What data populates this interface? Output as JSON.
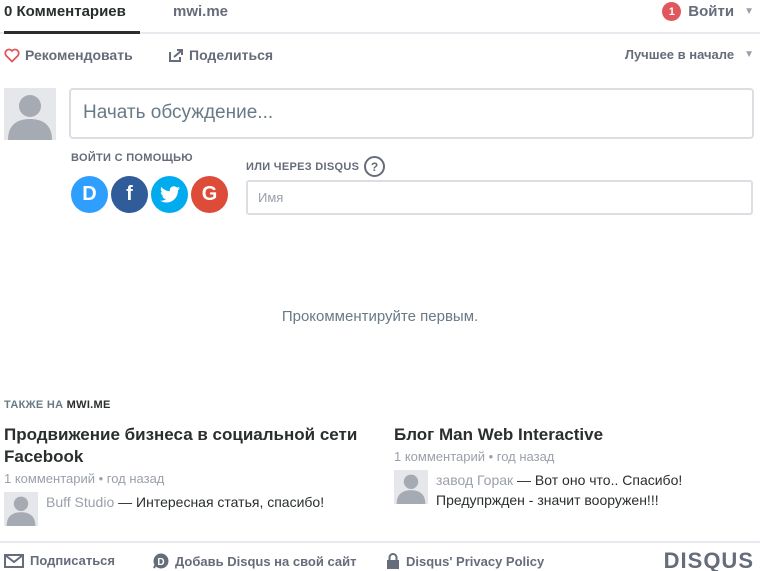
{
  "nav": {
    "comments_tab": "0 Комментариев",
    "site_tab": "mwi.me",
    "notification_count": "1",
    "login_label": "Войти"
  },
  "actions": {
    "recommend": "Рекомендовать",
    "share": "Поделиться",
    "sort": "Лучшее в начале"
  },
  "composer": {
    "placeholder": "Начать обсуждение...",
    "login_with_label": "ВОЙТИ С ПОМОЩЬЮ",
    "or_disqus_label": "ИЛИ ЧЕРЕЗ DISQUS",
    "help": "?",
    "name_placeholder": "Имя",
    "social": [
      {
        "name": "disqus",
        "glyph": "D",
        "color": "#2e9fff"
      },
      {
        "name": "facebook",
        "glyph": "f",
        "color": "#305c99"
      },
      {
        "name": "twitter",
        "glyph": "twitter-bird",
        "color": "#00aced"
      },
      {
        "name": "google",
        "glyph": "G",
        "color": "#dd4b39"
      }
    ]
  },
  "empty_state": "Прокомментируйте первым.",
  "also_on": {
    "label": "ТАКЖЕ НА",
    "site": "MWI.ME",
    "items": [
      {
        "title": "Продвижение бизнеса в социальной сети Facebook",
        "meta": "1 комментарий • год назад",
        "author": "Buff Studio",
        "text": "— Интересная статья, спасибо!"
      },
      {
        "title": "Блог Man Web Interactive",
        "meta": "1 комментарий • год назад",
        "author": "завод Горак",
        "text": "— Вот оно что.. Спасибо! Предупрждeн - значит вооружен!!!"
      }
    ]
  },
  "footer": {
    "subscribe": "Подписаться",
    "add_disqus": "Добавь Disqus на свой сайт",
    "privacy": "Disqus' Privacy Policy",
    "logo": "DISQUS"
  },
  "colors": {
    "accent_red": "#e0585d",
    "text_dark": "#2a2e2e",
    "text_muted": "#656c7a"
  }
}
